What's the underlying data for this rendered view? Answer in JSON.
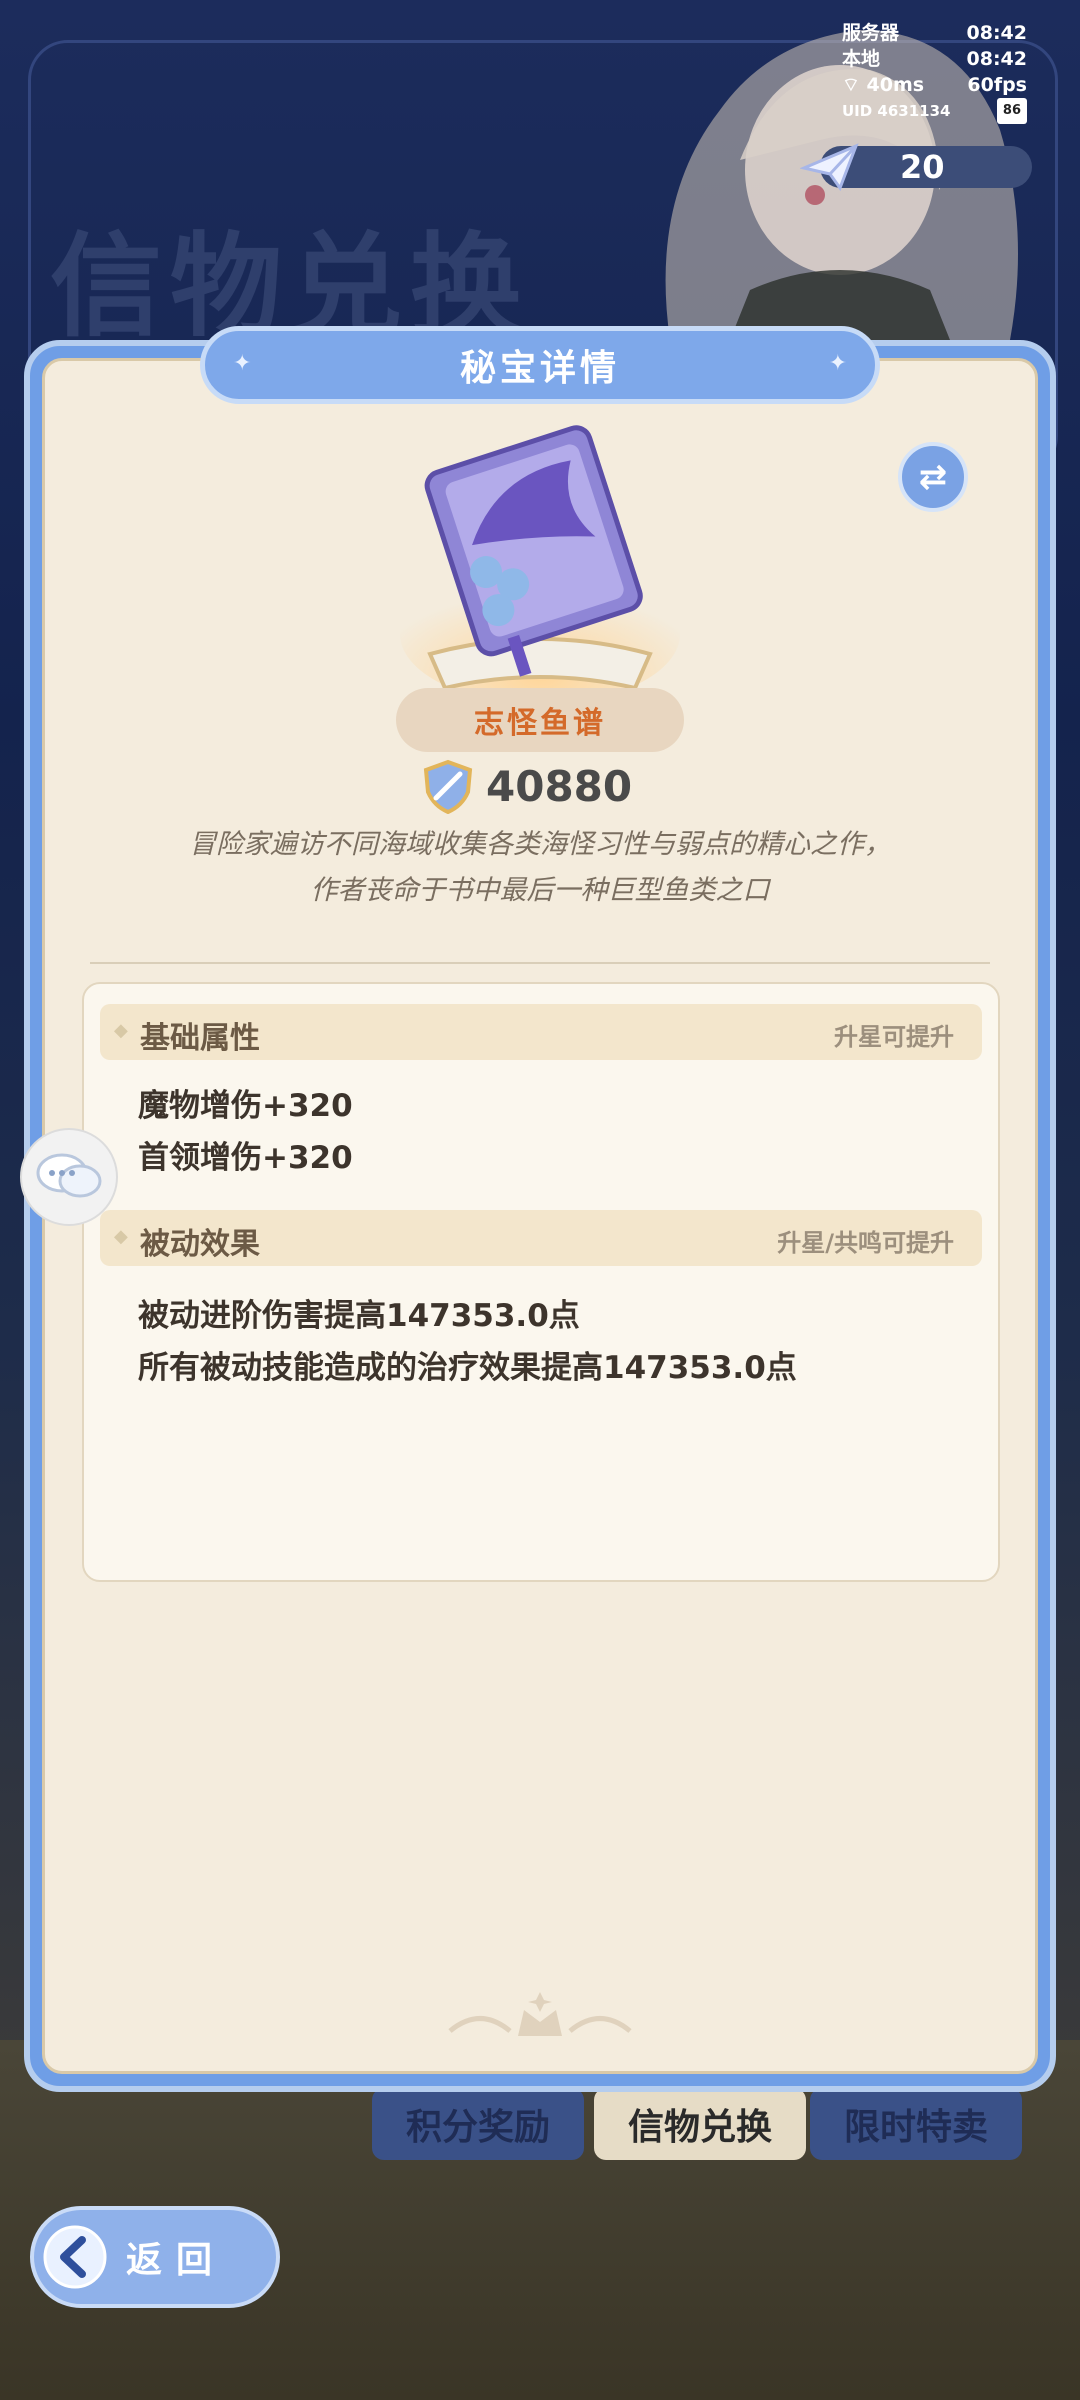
{
  "background": {
    "title": "信物兑换"
  },
  "hud": {
    "server_label": "服务器",
    "server_time": "08:42",
    "local_label": "本地",
    "local_time": "08:42",
    "ping": "40ms",
    "fps": "60fps",
    "uid": "UID 4631134",
    "battery": "86",
    "ticket_count": "20"
  },
  "tabs": [
    {
      "label": "积分奖励",
      "selected": false
    },
    {
      "label": "信物兑换",
      "selected": true
    },
    {
      "label": "限时特卖",
      "selected": false
    }
  ],
  "back_button": {
    "label": "返回"
  },
  "modal": {
    "title": "秘宝详情",
    "item_name": "志怪鱼谱",
    "price": "40880",
    "description_line1": "冒险家遍访不同海域收集各类海怪习性与弱点的精心之作，",
    "description_line2": "作者丧命于书中最后一种巨型鱼类之口",
    "sections": [
      {
        "title": "基础属性",
        "note": "升星可提升",
        "lines": [
          "魔物增伤+320",
          "首领增伤+320"
        ]
      },
      {
        "title": "被动效果",
        "note": "升星/共鸣可提升",
        "lines": [
          "被动进阶伤害提高147353.0点",
          "所有被动技能造成的治疗效果提高147353.0点"
        ]
      }
    ]
  },
  "colors": {
    "accent_blue": "#7ea8ea",
    "item_name_orange": "#d46a2a",
    "panel_bg": "#f4ecdd"
  },
  "icons": [
    "swap-icon",
    "chat-icon",
    "back-arrow-icon",
    "paper-plane-icon",
    "shield-sword-icon",
    "wifi-icon",
    "book-icon"
  ]
}
